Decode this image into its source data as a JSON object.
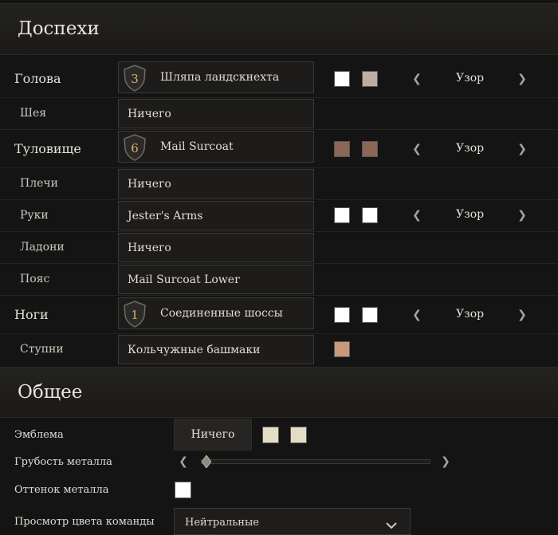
{
  "armor": {
    "title": "Доспехи",
    "slots": [
      {
        "label": "Голова",
        "item": "Шляпа ландскнехта",
        "tier": "3",
        "colors": [
          "#ffffff",
          "#c0aca2"
        ],
        "pattern": "Узор"
      },
      {
        "label": "Шея",
        "item": "Ничего"
      },
      {
        "label": "Туловище",
        "item": "Mail Surcoat",
        "tier": "6",
        "colors": [
          "#8c6656",
          "#8c6656"
        ],
        "pattern": "Узор"
      },
      {
        "label": "Плечи",
        "item": "Ничего"
      },
      {
        "label": "Руки",
        "item": "Jester's Arms",
        "colors": [
          "#ffffff",
          "#ffffff"
        ],
        "pattern": "Узор"
      },
      {
        "label": "Ладони",
        "item": "Ничего"
      },
      {
        "label": "Пояс",
        "item": "Mail Surcoat Lower"
      },
      {
        "label": "Ноги",
        "item": "Соединенные шоссы",
        "tier": "1",
        "colors": [
          "#ffffff",
          "#ffffff"
        ],
        "pattern": "Узор"
      },
      {
        "label": "Ступни",
        "item": "Кольчужные башмаки",
        "colors": [
          "#c8987a"
        ]
      }
    ]
  },
  "general": {
    "title": "Общее",
    "emblem": {
      "label": "Эмблема",
      "value": "Ничего",
      "colors": [
        "#e4dcc4",
        "#e4dcc4"
      ]
    },
    "metal_roughness": {
      "label": "Грубость металла",
      "value": 0.0
    },
    "metal_tint": {
      "label": "Оттенок металла",
      "color": "#ffffff"
    },
    "team_color_preview": {
      "label": "Просмотр цвета команды",
      "value": "Нейтральные"
    }
  }
}
